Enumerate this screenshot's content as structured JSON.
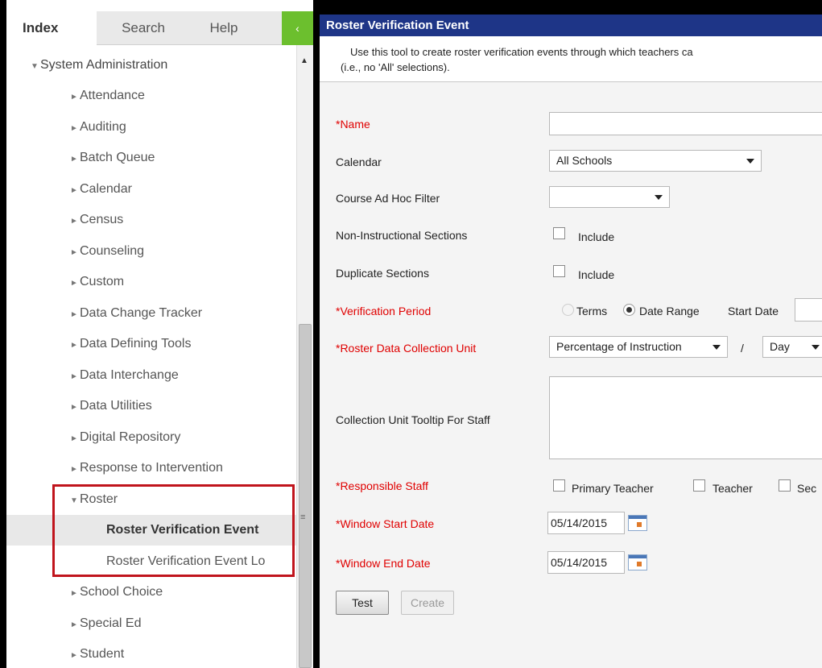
{
  "nav": {
    "tabs": {
      "index": "Index",
      "search": "Search",
      "help": "Help"
    },
    "collapse_glyph": "‹",
    "tree": [
      {
        "label": "System Administration",
        "level": 0,
        "expanded": true
      },
      {
        "label": "Attendance",
        "level": 1
      },
      {
        "label": "Auditing",
        "level": 1
      },
      {
        "label": "Batch Queue",
        "level": 1
      },
      {
        "label": "Calendar",
        "level": 1
      },
      {
        "label": "Census",
        "level": 1
      },
      {
        "label": "Counseling",
        "level": 1
      },
      {
        "label": "Custom",
        "level": 1
      },
      {
        "label": "Data Change Tracker",
        "level": 1
      },
      {
        "label": "Data Defining Tools",
        "level": 1
      },
      {
        "label": "Data Interchange",
        "level": 1
      },
      {
        "label": "Data Utilities",
        "level": 1
      },
      {
        "label": "Digital Repository",
        "level": 1
      },
      {
        "label": "Response to Intervention",
        "level": 1
      },
      {
        "label": "Roster",
        "level": 1,
        "expanded": true
      },
      {
        "label": "Roster Verification Event",
        "level": 2,
        "selected": true
      },
      {
        "label": "Roster Verification Event Lo",
        "level": 2
      },
      {
        "label": "School Choice",
        "level": 1
      },
      {
        "label": "Special Ed",
        "level": 1
      },
      {
        "label": "Student",
        "level": 1
      }
    ]
  },
  "panel": {
    "title": "Roster Verification Event",
    "desc_line1": "Use this tool to create roster verification events through which teachers ca",
    "desc_line2": "(i.e., no 'All' selections).",
    "form": {
      "name_label": "*Name",
      "calendar_label": "Calendar",
      "calendar_value": "All Schools",
      "adhoc_label": "Course Ad Hoc Filter",
      "adhoc_value": "",
      "noninstr_label": "Non-Instructional Sections",
      "noninstr_include": "Include",
      "dup_label": "Duplicate Sections",
      "dup_include": "Include",
      "period_label": "*Verification Period",
      "period_terms": "Terms",
      "period_range": "Date Range",
      "start_date_label": "Start Date",
      "unit_label": "*Roster Data Collection Unit",
      "unit_value": "Percentage of Instruction",
      "unit_sep": "/",
      "unit_per": "Day",
      "tooltip_label": "Collection Unit Tooltip For Staff",
      "staff_label": "*Responsible Staff",
      "staff_primary": "Primary Teacher",
      "staff_teacher": "Teacher",
      "staff_sec": "Sec",
      "win_start_label": "*Window Start Date",
      "win_start_value": "05/14/2015",
      "win_end_label": "*Window End Date",
      "win_end_value": "05/14/2015",
      "test_button": "Test",
      "create_button": "Create"
    }
  },
  "colors": {
    "title_bar": "#1e3587",
    "required": "#e00000",
    "accent_green": "#6cbf2e",
    "highlight_box": "#c0141c"
  }
}
